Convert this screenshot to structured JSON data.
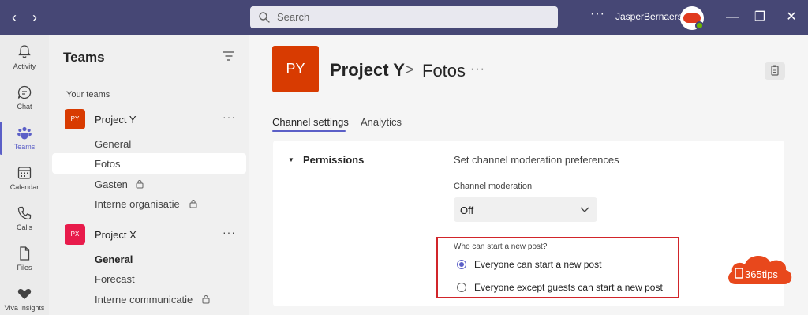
{
  "titlebar": {
    "back_glyph": "‹",
    "forward_glyph": "›",
    "search_placeholder": "Search",
    "more_glyph": "···",
    "user_name": "JasperBernaers",
    "minimize_glyph": "—",
    "restore_glyph": "❐",
    "close_glyph": "✕",
    "bg_color": "#464775"
  },
  "rail": {
    "items": [
      {
        "label": "Activity",
        "icon": "bell-icon"
      },
      {
        "label": "Chat",
        "icon": "chat-icon"
      },
      {
        "label": "Teams",
        "icon": "teams-icon",
        "active": true
      },
      {
        "label": "Calendar",
        "icon": "calendar-icon"
      },
      {
        "label": "Calls",
        "icon": "phone-icon"
      },
      {
        "label": "Files",
        "icon": "file-icon"
      },
      {
        "label": "Viva Insights",
        "icon": "heart-icon"
      }
    ],
    "accent_color": "#5b5fc7"
  },
  "panel": {
    "title": "Teams",
    "section_label": "Your teams",
    "teams": [
      {
        "initials": "PY",
        "name": "Project Y",
        "more": "···",
        "color": "#d83b01",
        "channels": [
          {
            "name": "General"
          },
          {
            "name": "Fotos",
            "selected": true
          },
          {
            "name": "Gasten",
            "private": true
          },
          {
            "name": "Interne organisatie",
            "private": true
          }
        ]
      },
      {
        "initials": "PX",
        "name": "Project X",
        "more": "···",
        "color": "#e81b4b",
        "channels": [
          {
            "name": "General",
            "bold": true
          },
          {
            "name": "Forecast"
          },
          {
            "name": "Interne communicatie",
            "private": true
          }
        ]
      }
    ]
  },
  "main": {
    "avatar_initials": "PY",
    "team_name": "Project Y",
    "separator": ">",
    "channel_name": "Fotos",
    "more": "···",
    "tabs": [
      {
        "label": "Channel settings",
        "active": true
      },
      {
        "label": "Analytics"
      }
    ],
    "permissions": {
      "caret": "▼",
      "title": "Permissions",
      "description": "Set channel moderation preferences",
      "moderation_label": "Channel moderation",
      "moderation_value": "Off",
      "who_label": "Who can start a new post?",
      "options": [
        {
          "label": "Everyone can start a new post",
          "checked": true
        },
        {
          "label": "Everyone except guests can start a new post",
          "checked": false
        }
      ]
    }
  },
  "watermark": {
    "text": "365tips",
    "color": "#e8481c"
  }
}
